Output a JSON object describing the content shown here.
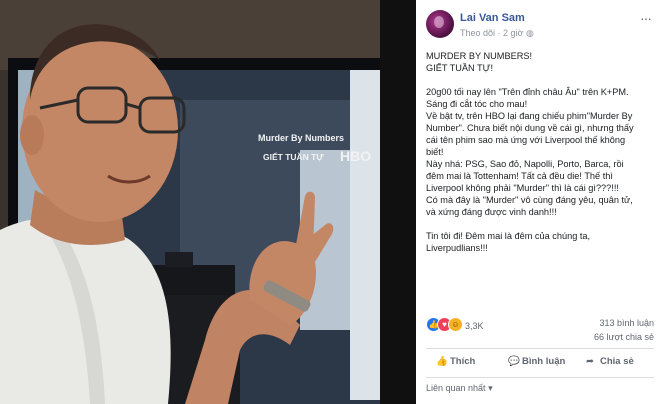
{
  "post": {
    "author": "Lai Van Sam",
    "follow_label": "Theo dõi",
    "time": "2 giờ",
    "more_label": "···",
    "paragraphs": [
      [
        "MURDER BY NUMBERS!",
        "GIẾT TUẦN TỰ!"
      ],
      [
        "20g00 tối nay lên \"Trên đỉnh châu Âu\" trên K+PM.",
        "Sáng đi cắt tóc cho mau!",
        "Về bật tv, trên HBO lại đang chiếu phim\"Murder By",
        "Number\". Chưa biết nội dung về cái gì, nhưng thấy",
        "cái tên phim sao mà ứng với Liverpool thế không",
        "biết!",
        "Này nhá: PSG, Sao đỏ, Napolli, Porto, Barca, rồi",
        "đêm mai là Tottenham! Tất cả đều die! Thế thì",
        "Liverpool không phải \"Murder\" thì là cái gì???!!!",
        "Có mà đây là \"Murder\" vô cùng đáng yêu, quân tử,",
        "và xứng đáng được vinh danh!!!"
      ],
      [
        "Tin tôi đi! Đêm mai là đêm của chúng ta,",
        "Liverpudlians!!!"
      ]
    ]
  },
  "stats": {
    "reactions_count": "3,3K",
    "comments": "313 bình luận",
    "shares": "66 lượt chia sẻ"
  },
  "actions": {
    "like": "Thích",
    "comment": "Bình luận",
    "share": "Chia sẻ"
  },
  "related_label": "Liên quan nhất",
  "photo": {
    "tv_title_line1": "Murder By Numbers",
    "tv_title_line2": "GIẾT TUẦN TỰ",
    "tv_logo": "HBO"
  },
  "icons": {
    "like": "like-icon",
    "love": "love-icon",
    "haha": "haha-icon",
    "comment": "comment-icon",
    "share": "share-icon",
    "dropdown": "chevron-down-icon",
    "globe": "globe-icon"
  },
  "colors": {
    "author_blue": "#385898",
    "like_blue": "#2078f4",
    "love_red": "#f33e58",
    "haha_yellow": "#f7b125"
  }
}
